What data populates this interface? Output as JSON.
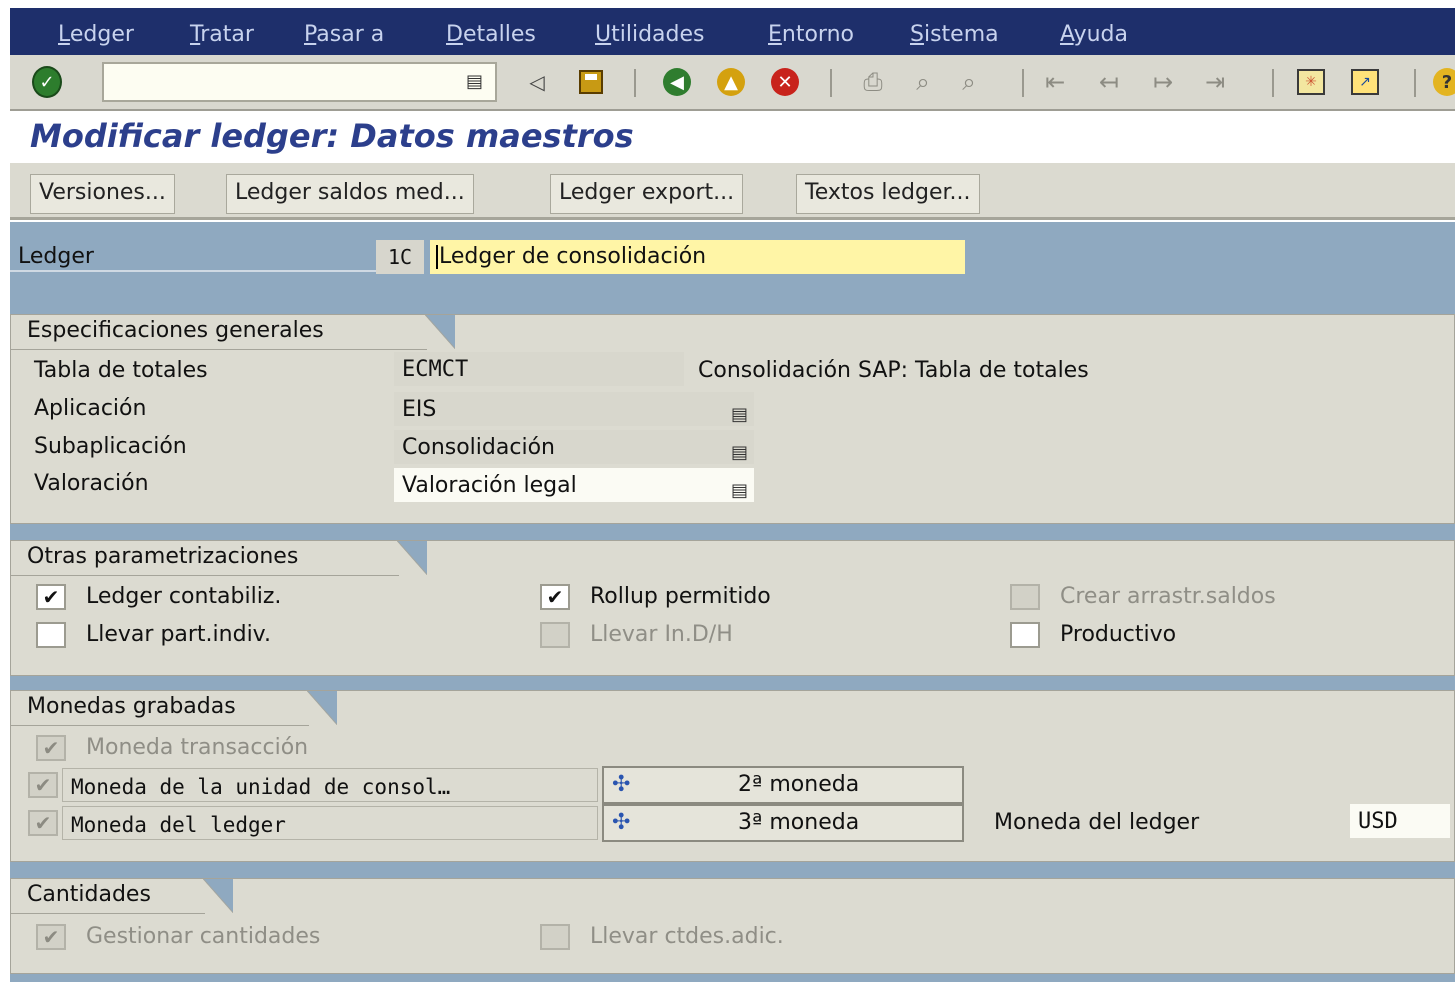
{
  "menu": [
    "Ledger",
    "Tratar",
    "Pasar a",
    "Detalles",
    "Utilidades",
    "Entorno",
    "Sistema",
    "Ayuda"
  ],
  "toolbar": {
    "icons": [
      "enter-icon",
      "command-field",
      "back-arrow-icon",
      "save-icon",
      "back-icon",
      "exit-icon",
      "cancel-icon",
      "print-icon",
      "find-icon",
      "find-next-icon",
      "first-page-icon",
      "previous-page-icon",
      "next-page-icon",
      "last-page-icon",
      "create-session-icon",
      "shortcut-icon",
      "help-icon"
    ]
  },
  "title": "Modificar ledger: Datos maestros",
  "app_buttons": [
    "Versiones...",
    "Ledger saldos med...",
    "Ledger export...",
    "Textos ledger..."
  ],
  "ledger": {
    "label": "Ledger",
    "code": "1C",
    "description": "Ledger de consolidación"
  },
  "general": {
    "title": "Especificaciones generales",
    "tabla_label": "Tabla de totales",
    "tabla_value": "ECMCT",
    "tabla_desc": "Consolidación SAP: Tabla de totales",
    "aplic_label": "Aplicación",
    "aplic_value": "EIS",
    "subaplic_label": "Subaplicación",
    "subaplic_value": "Consolidación",
    "valor_label": "Valoración",
    "valor_value": "Valoración legal"
  },
  "otras": {
    "title": "Otras parametrizaciones",
    "items": [
      {
        "label": "Ledger contabiliz.",
        "checked": true,
        "enabled": true
      },
      {
        "label": "Rollup permitido",
        "checked": true,
        "enabled": true
      },
      {
        "label": "Crear arrastr.saldos",
        "checked": false,
        "enabled": false
      },
      {
        "label": "Llevar part.indiv.",
        "checked": false,
        "enabled": true
      },
      {
        "label": "Llevar In.D/H",
        "checked": false,
        "enabled": false
      },
      {
        "label": "Productivo",
        "checked": false,
        "enabled": true
      }
    ]
  },
  "monedas": {
    "title": "Monedas grabadas",
    "transaccion": "Moneda transacción",
    "unidad": "Moneda de la unidad de consol…",
    "ledger_row": "Moneda del ledger",
    "btn2": "2ª moneda",
    "btn3": "3ª moneda",
    "ledger_cur_label": "Moneda del ledger",
    "ledger_cur_value": "USD"
  },
  "cantidades": {
    "title": "Cantidades",
    "gestionar": "Gestionar cantidades",
    "adic": "Llevar ctdes.adic."
  },
  "check_mark": "✔"
}
